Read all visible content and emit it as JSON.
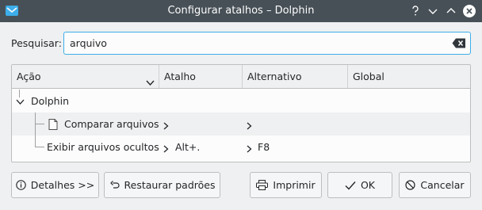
{
  "window": {
    "title": "Configurar atalhos – Dolphin",
    "buttons": [
      "help-icon",
      "minimize-icon",
      "maximize-icon",
      "close-icon"
    ]
  },
  "search": {
    "label": "Pesquisar:",
    "value": "arquivo"
  },
  "tree": {
    "columns": [
      "Ação",
      "Atalho",
      "Alternativo",
      "Global"
    ],
    "group": "Dolphin",
    "rows": [
      {
        "action": "Comparar arquivos",
        "shortcut": "",
        "alternative": ""
      },
      {
        "action": "Exibir arquivos ocultos",
        "shortcut": "Alt+.",
        "alternative": "F8"
      }
    ]
  },
  "buttons": {
    "details": "Detalhes >>",
    "restore": "Restaurar padrões",
    "print": "Imprimir",
    "ok": "OK",
    "cancel": "Cancelar"
  },
  "colors": {
    "titlebar": "#475057",
    "accent": "#3daee9",
    "window": "#eff0f1"
  }
}
